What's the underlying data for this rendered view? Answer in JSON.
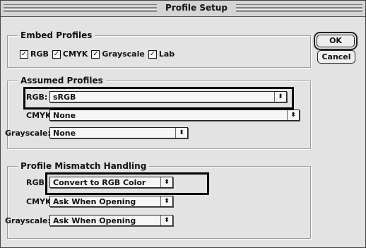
{
  "window": {
    "title": "Profile Setup"
  },
  "buttons": {
    "ok": "OK",
    "cancel": "Cancel"
  },
  "embed_profiles": {
    "label": "Embed Profiles",
    "items": [
      {
        "label": "RGB",
        "checked": true
      },
      {
        "label": "CMYK",
        "checked": true
      },
      {
        "label": "Grayscale",
        "checked": true
      },
      {
        "label": "Lab",
        "checked": true
      }
    ]
  },
  "assumed_profiles": {
    "label": "Assumed Profiles",
    "rgb": {
      "label": "RGB:",
      "value": "sRGB"
    },
    "cmyk": {
      "label": "CMYK:",
      "value": "None"
    },
    "grayscale": {
      "label": "Grayscale:",
      "value": "None"
    }
  },
  "mismatch": {
    "label": "Profile Mismatch Handling",
    "rgb": {
      "label": "RGB:",
      "value": "Convert to RGB Color"
    },
    "cmyk": {
      "label": "CMYK:",
      "value": "Ask When Opening"
    },
    "grayscale": {
      "label": "Grayscale:",
      "value": "Ask When Opening"
    }
  },
  "icons": {
    "check": "✓",
    "popup_arrow": "⬍"
  }
}
